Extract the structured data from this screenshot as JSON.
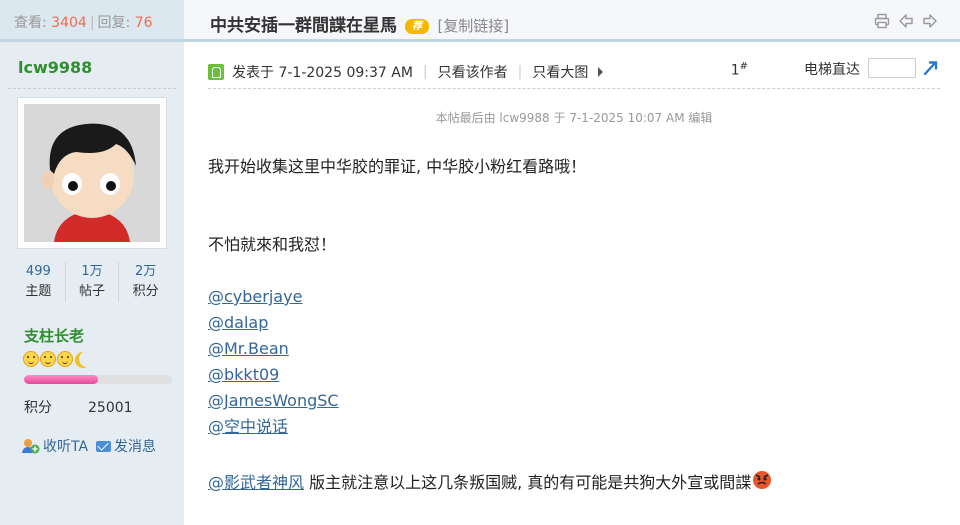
{
  "stats": {
    "views_label": "查看:",
    "views": "3404",
    "replies_label": "回复:",
    "replies": "76"
  },
  "thread": {
    "title": "中共安插一群間諜在星馬",
    "badge": "荐",
    "copy_link": "[复制链接]"
  },
  "user": {
    "username": "lcw9988",
    "counts": [
      {
        "value": "499",
        "label": "主题"
      },
      {
        "value": "1万",
        "label": "帖子"
      },
      {
        "value": "2万",
        "label": "积分"
      }
    ],
    "rank_title": "支柱长老",
    "rank_progress": 0.5,
    "points_label": "积分",
    "points_value": "25001",
    "follow_label": "收听TA",
    "message_label": "发消息"
  },
  "post_meta": {
    "posted_at": "发表于 7-1-2025 09:37 AM",
    "author_only": "只看该作者",
    "large_image": "只看大图",
    "floor": "1",
    "floor_mark": "#",
    "elevator_label": "电梯直达"
  },
  "edit_note": "本帖最后由 lcw9988 于 7-1-2025 10:07 AM 编辑",
  "body": {
    "line1": "我开始收集这里中华胶的罪证, 中华胶小粉红看路哦！",
    "line2": "不怕就來和我怼！",
    "mentions": [
      "@cyberjaye",
      "@dalap",
      "@Mr.Bean",
      "@bkkt09",
      "@JamesWongSC",
      "@空中说话"
    ],
    "final_mention": "@影武者神风",
    "final_text": " 版主就注意以上这几条叛国贼, 真的有可能是共狗大外宣或間諜"
  },
  "colors": {
    "accent_blue": "#336699",
    "green": "#2f8f2f",
    "highlight": "#f26c4f",
    "progress": "#e5489c"
  },
  "icons": [
    "print-icon",
    "prev-thread-icon",
    "next-thread-icon",
    "online-icon",
    "elevator-go-icon",
    "follow-icon",
    "mail-icon",
    "angry-emoji"
  ]
}
